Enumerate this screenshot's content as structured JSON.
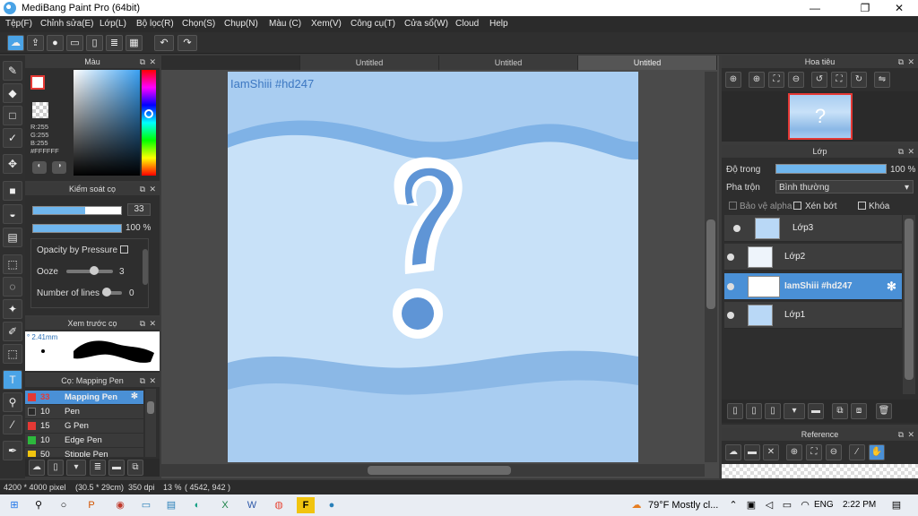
{
  "window": {
    "title": "MediBang Paint Pro (64bit)",
    "min": "—",
    "max": "❐",
    "close": "✕"
  },
  "menu": [
    "Tệp(F)",
    "Chỉnh sửa(E)",
    "Lớp(L)",
    "Bộ lọc(R)",
    "Chọn(S)",
    "Chụp(N)",
    "Màu (C)",
    "Xem(V)",
    "Công cụ(T)",
    "Cửa sổ(W)",
    "Cloud",
    "Help"
  ],
  "color_panel": {
    "title": "Màu",
    "r": "R:255",
    "g": "G:255",
    "b": "B:255",
    "hex": "#FFFFFF"
  },
  "brush_control": {
    "title": "Kiểm soát cọ",
    "size": "33",
    "opacity": "100 %",
    "opacity_by_pressure": "Opacity by Pressure",
    "ooze_label": "Ooze",
    "ooze_value": "3",
    "lines_label": "Number of lines",
    "lines_value": "0"
  },
  "brush_preview": {
    "title": "Xem trước cọ",
    "size": "2.41mm"
  },
  "brush_list": {
    "title": "Cọ: Mapping Pen",
    "items": [
      {
        "size": "33",
        "name": "Mapping Pen",
        "color": "#e53935",
        "selected": true
      },
      {
        "size": "10",
        "name": "Pen",
        "color": "#3a3a3a",
        "selected": false
      },
      {
        "size": "15",
        "name": "G Pen",
        "color": "#e53935",
        "selected": false
      },
      {
        "size": "10",
        "name": "Edge Pen",
        "color": "#2db83d",
        "selected": false
      },
      {
        "size": "50",
        "name": "Stipple Pen",
        "color": "#f1c40f",
        "selected": false
      }
    ]
  },
  "tabs": [
    "Untitled",
    "Untitled",
    "Untitled"
  ],
  "canvas": {
    "watermark": "IamShiii #hd247"
  },
  "navigator": {
    "title": "Hoa tiêu"
  },
  "layer_panel": {
    "title": "Lớp",
    "opacity_label": "Độ trong",
    "opacity_value": "100 %",
    "blend_label": "Pha trộn",
    "blend_value": "Bình thường",
    "protect_alpha": "Bảo vệ alpha",
    "clipping": "Xén bớt",
    "lock": "Khóa",
    "layers": [
      {
        "name": "Lớp3",
        "selected": false
      },
      {
        "name": "Lớp2",
        "selected": false
      },
      {
        "name": "IamShiii #hd247",
        "selected": true
      },
      {
        "name": "Lớp1",
        "selected": false
      }
    ]
  },
  "reference": {
    "title": "Reference"
  },
  "status": {
    "size": "4200 * 4000 pixel",
    "cm": "(30.5 * 29cm)",
    "dpi": "350 dpi",
    "zoom": "13 %",
    "coords": "( 4542, 942 )"
  },
  "taskbar": {
    "weather": "79°F  Mostly cl...",
    "lang": "ENG",
    "time": "2:22 PM"
  }
}
